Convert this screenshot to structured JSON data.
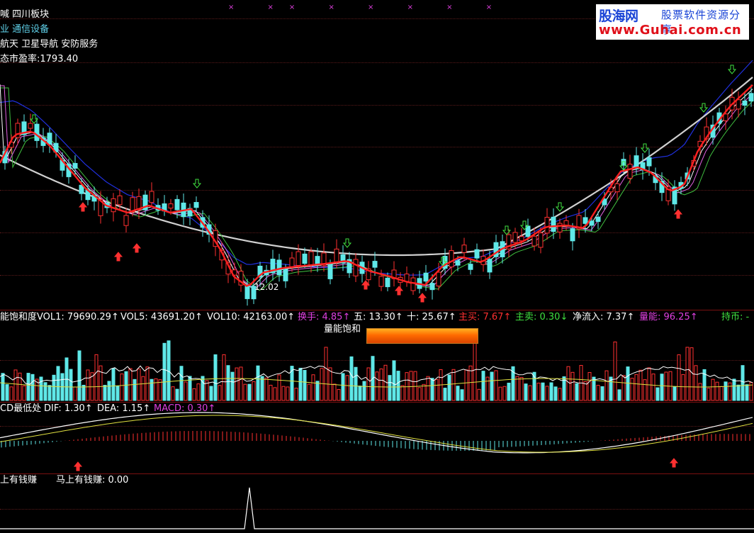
{
  "header": {
    "lines": [
      "喊 四川板块",
      "业 通信设备",
      "航天 卫星导航 安防服务",
      "态市盈率:1793.40"
    ],
    "line_colors": [
      "#ffffff",
      "#5fd0e8",
      "#ffffff",
      "#ffffff"
    ]
  },
  "watermark": {
    "logo": "股海网",
    "slogan": "股票软件资源分享",
    "url": "www.Guhai.com.cn"
  },
  "main_chart": {
    "low_label": "12.02",
    "markers": {
      "up_color": "#ff3030",
      "down_color": "#40e040",
      "ma5_color": "#ff2020",
      "ma10_color": "#ffffff",
      "ma20_color": "#e060e0",
      "ma30_color": "#40c040",
      "ma60_color": "#d0d0d0",
      "ma120_color": "#2030e0"
    }
  },
  "volume_panel": {
    "items": [
      {
        "text": "能饱和度",
        "color": "#ffffff"
      },
      {
        "text": "VOL1: 79690.29↑",
        "color": "#ffffff"
      },
      {
        "text": "VOL5: 43691.20↑",
        "color": "#ffffff"
      },
      {
        "text": "VOL10: 42163.00↑",
        "color": "#ffffff"
      },
      {
        "text": "换手: 4.85↑",
        "color": "#e040e0"
      },
      {
        "text": "五: 13.30↑",
        "color": "#ffffff"
      },
      {
        "text": "十: 25.67↑",
        "color": "#ffffff"
      },
      {
        "text": "主买: 7.67↑",
        "color": "#ff3030"
      },
      {
        "text": "主卖: 0.30↓",
        "color": "#40e040"
      },
      {
        "text": "净流入: 7.37↑",
        "color": "#ffffff"
      },
      {
        "text": "量能: 96.25↑",
        "color": "#e040e0"
      },
      {
        "text": "持币: -",
        "color": "#40e040"
      }
    ],
    "saturation_label": "量能饱和"
  },
  "macd_panel": {
    "items": [
      {
        "text": "CD最低处",
        "color": "#ffffff"
      },
      {
        "text": "DIF: 1.30↑",
        "color": "#ffffff"
      },
      {
        "text": "DEA: 1.15↑",
        "color": "#ffffff"
      },
      {
        "text": "MACD: 0.30↑",
        "color": "#e040e0"
      }
    ]
  },
  "signal_panel": {
    "items": [
      {
        "text": "上有钱赚",
        "color": "#ffffff"
      },
      {
        "text": "马上有钱赚: 0.00",
        "color": "#ffffff"
      }
    ]
  },
  "top_marks": "× ×× × × × × ×"
}
